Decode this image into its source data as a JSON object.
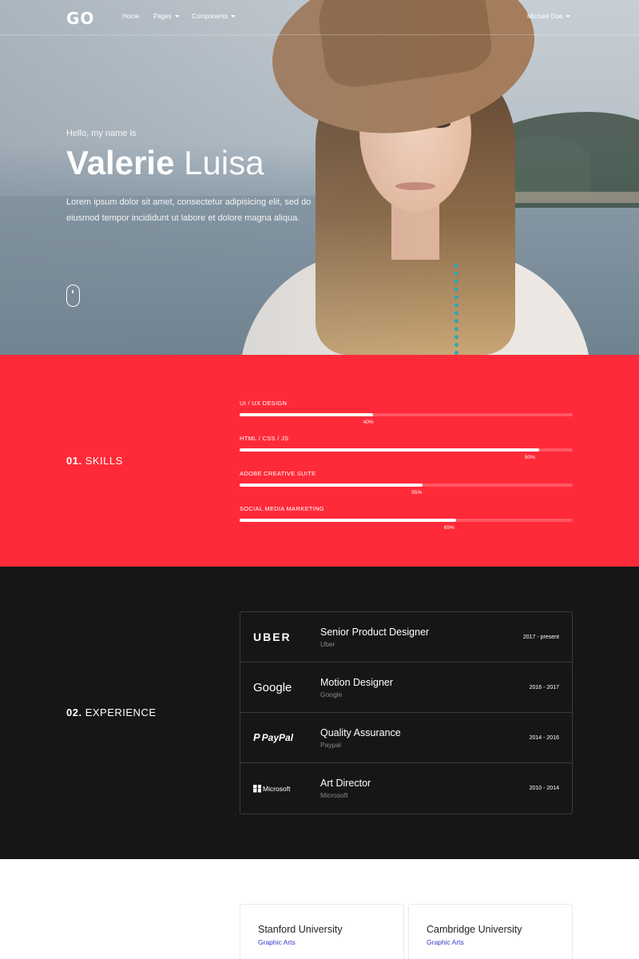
{
  "nav": {
    "logo": "GO",
    "links": [
      "Home",
      "Pages",
      "Components"
    ],
    "user": "Michael Doe"
  },
  "hero": {
    "greeting": "Hello, my name is",
    "first_name": "Valerie",
    "last_name": "Luisa",
    "intro": "Lorem ipsum dolor sit amet, consectetur adipisicing elit, sed do eiusmod tempor incididunt ut labore et dolore magna aliqua."
  },
  "skills": {
    "number": "01.",
    "title": "SKILLS",
    "items": [
      {
        "label": "UI / UX DESIGN",
        "percent": 40,
        "percent_label": "40%"
      },
      {
        "label": "HTML / CSS / JS",
        "percent": 90,
        "percent_label": "90%"
      },
      {
        "label": "ADOBE CREATIVE SUITE",
        "percent": 55,
        "percent_label": "55%"
      },
      {
        "label": "SOCIAL MEDIA MARKETING",
        "percent": 65,
        "percent_label": "65%"
      }
    ]
  },
  "experience": {
    "number": "02.",
    "title": "EXPERIENCE",
    "items": [
      {
        "logo": "UBER",
        "role": "Senior Product Designer",
        "company": "Uber",
        "years": "2017 - present"
      },
      {
        "logo": "Google",
        "role": "Motion Designer",
        "company": "Google",
        "years": "2016 - 2017"
      },
      {
        "logo": "PayPal",
        "role": "Quality Assurance",
        "company": "Paypal",
        "years": "2014 - 2016"
      },
      {
        "logo": "Microsoft",
        "role": "Art Director",
        "company": "Microsoft",
        "years": "2010 - 2014"
      }
    ]
  },
  "education": {
    "items": [
      {
        "school": "Stanford University",
        "degree": "Graphic Arts"
      },
      {
        "school": "Cambridge University",
        "degree": "Graphic Arts"
      }
    ]
  },
  "colors": {
    "accent": "#ff2a39",
    "dark": "#161617",
    "link": "#3b35c9"
  }
}
